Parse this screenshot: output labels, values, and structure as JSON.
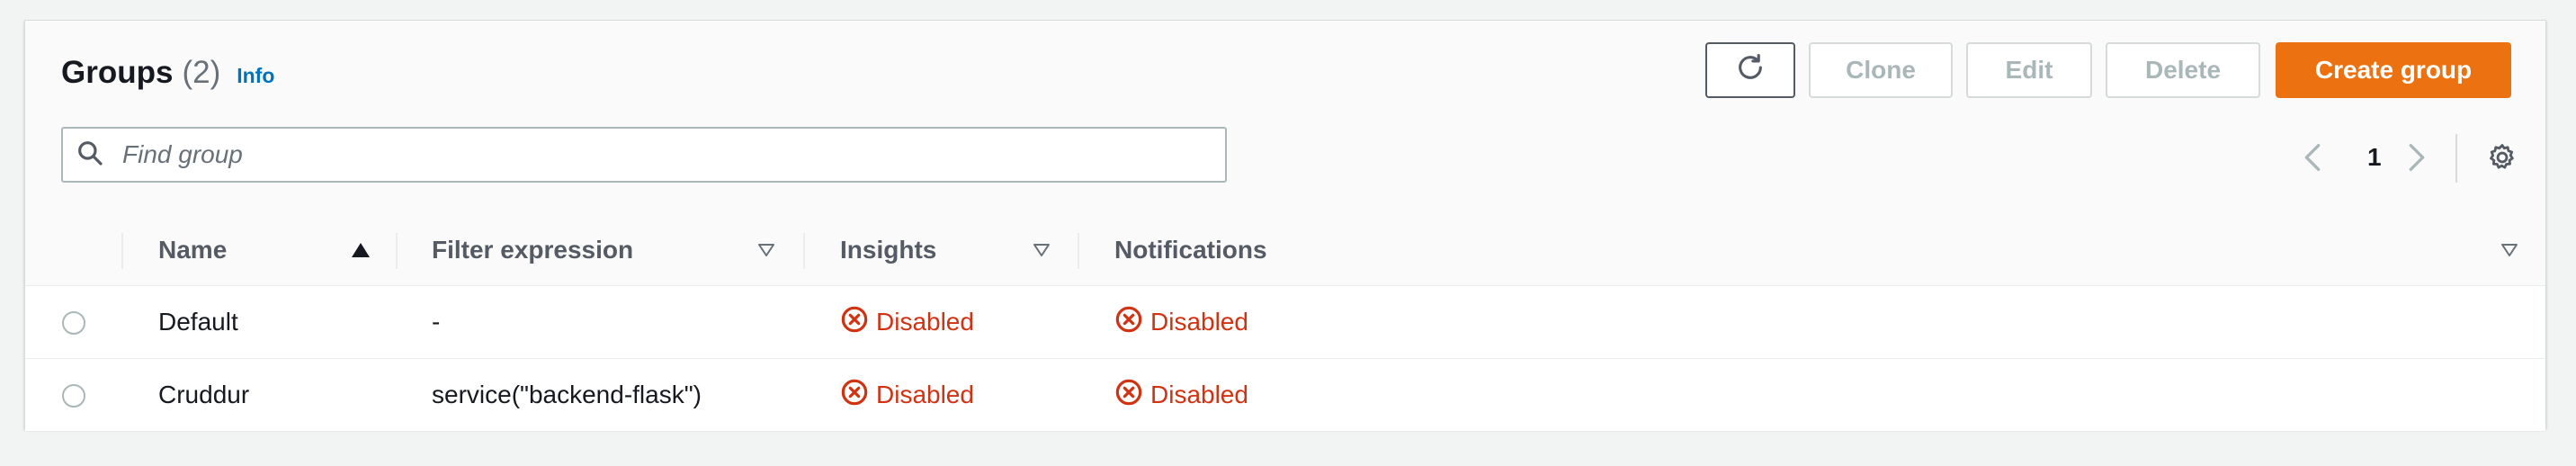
{
  "header": {
    "title": "Groups",
    "count": "(2)",
    "info_label": "Info"
  },
  "toolbar": {
    "refresh_icon": "refresh-icon",
    "clone_label": "Clone",
    "edit_label": "Edit",
    "delete_label": "Delete",
    "create_label": "Create group"
  },
  "search": {
    "placeholder": "Find group",
    "value": ""
  },
  "pagination": {
    "current_page": "1"
  },
  "table": {
    "columns": [
      {
        "label": "Name",
        "sort": "ascending"
      },
      {
        "label": "Filter expression",
        "sort": "none"
      },
      {
        "label": "Insights",
        "sort": "none"
      },
      {
        "label": "Notifications",
        "sort": "none"
      }
    ],
    "rows": [
      {
        "name": "Default",
        "filter_expression": "-",
        "insights": "Disabled",
        "notifications": "Disabled"
      },
      {
        "name": "Cruddur",
        "filter_expression": "service(\"backend-flask\")",
        "insights": "Disabled",
        "notifications": "Disabled"
      }
    ]
  },
  "colors": {
    "accent": "#ec7211",
    "link": "#0073bb",
    "status_error": "#d13212",
    "disabled_text": "#aab7b8"
  }
}
